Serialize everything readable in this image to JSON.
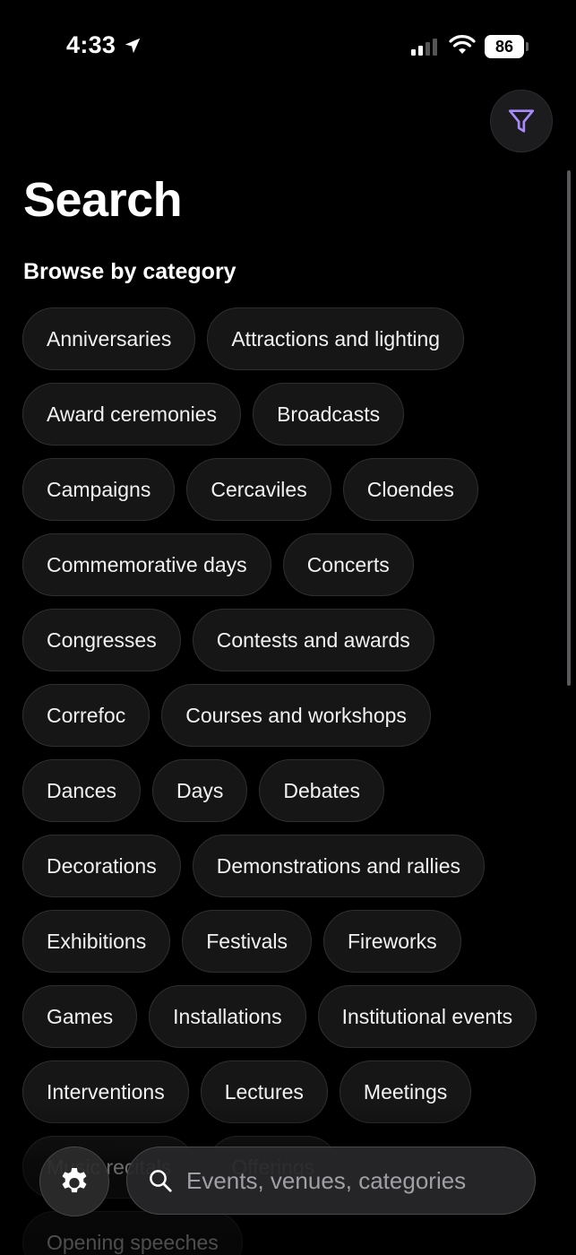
{
  "status_bar": {
    "time": "4:33",
    "battery": "86",
    "location_icon": "location-arrow-icon",
    "signal_icon": "cellular-signal-icon",
    "wifi_icon": "wifi-icon"
  },
  "header": {
    "filter_icon": "filter-icon",
    "accent_color": "#a78bfa"
  },
  "page": {
    "title": "Search",
    "section_title": "Browse by category"
  },
  "categories": [
    "Anniversaries",
    "Attractions and lighting",
    "Award ceremonies",
    "Broadcasts",
    "Campaigns",
    "Cercaviles",
    "Cloendes",
    "Commemorative days",
    "Concerts",
    "Congresses",
    "Contests and awards",
    "Correfoc",
    "Courses and workshops",
    "Dances",
    "Days",
    "Debates",
    "Decorations",
    "Demonstrations and rallies",
    "Exhibitions",
    "Festivals",
    "Fireworks",
    "Games",
    "Installations",
    "Institutional events",
    "Interventions",
    "Lectures",
    "Meetings",
    "Music recitals",
    "Offerings",
    "Opening speeches"
  ],
  "bottom_bar": {
    "settings_icon": "gear-icon",
    "search_icon": "search-icon",
    "search_placeholder": "Events, venues, categories"
  }
}
